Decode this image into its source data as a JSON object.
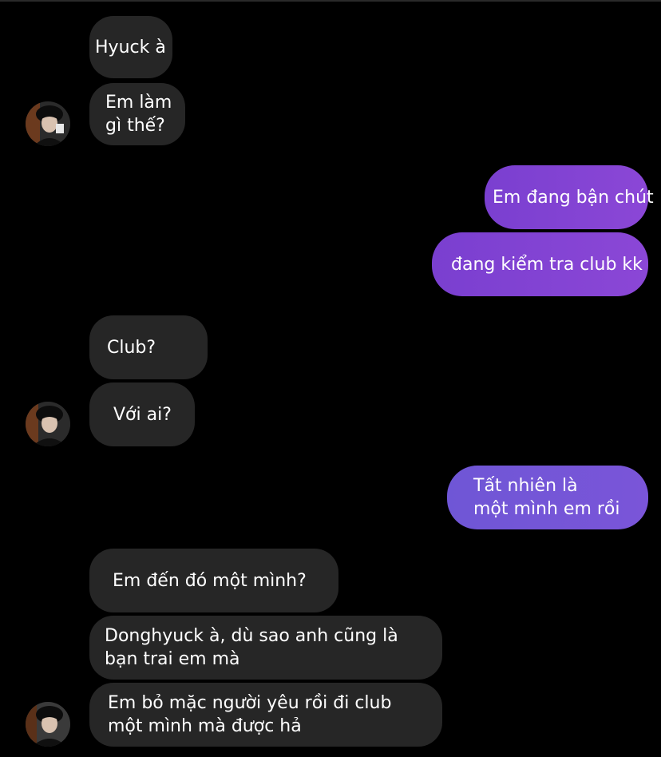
{
  "colors": {
    "background": "#000000",
    "received_bubble": "#262626",
    "sent_bubble": "#8446d4"
  },
  "avatar_icon": "profile-photo",
  "messages": [
    {
      "from": "them",
      "lines": [
        "Hyuck à"
      ]
    },
    {
      "from": "them",
      "lines": [
        "Em làm",
        "gì thế?"
      ]
    },
    {
      "from": "me",
      "lines": [
        "Em đang bận chút"
      ]
    },
    {
      "from": "me",
      "lines": [
        "đang kiểm tra club kk"
      ]
    },
    {
      "from": "them",
      "lines": [
        "Club?"
      ]
    },
    {
      "from": "them",
      "lines": [
        "Với ai?"
      ]
    },
    {
      "from": "me",
      "lines": [
        "Tất nhiên là",
        "một mình em rồi"
      ]
    },
    {
      "from": "them",
      "lines": [
        "Em đến đó một mình?"
      ]
    },
    {
      "from": "them",
      "lines": [
        "Donghyuck à, dù sao anh cũng là",
        "bạn trai em mà"
      ]
    },
    {
      "from": "them",
      "lines": [
        "Em bỏ mặc người yêu rồi đi club",
        "một mình mà được hả"
      ]
    }
  ]
}
